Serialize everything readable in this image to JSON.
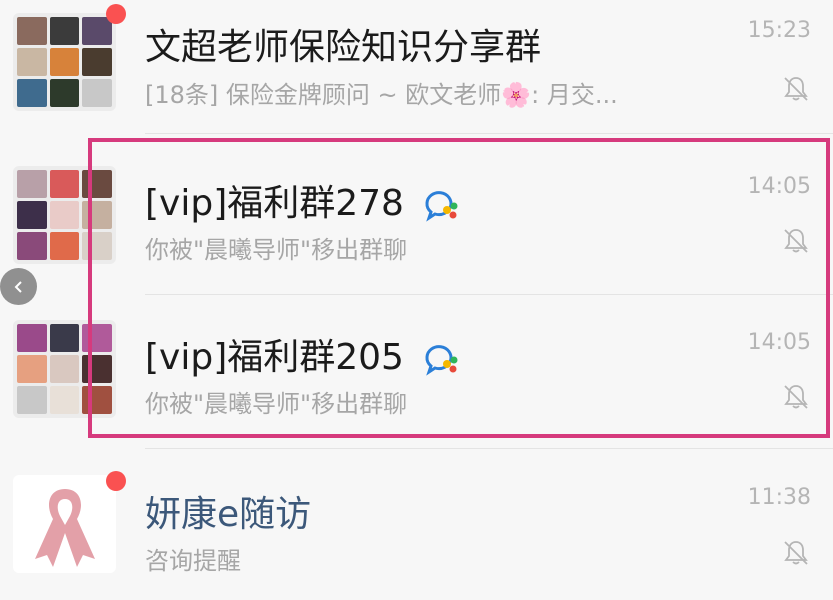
{
  "chats": [
    {
      "title": "文超老师保险知识分享群",
      "preview": "[18条] 保险金牌顾问 ~ 欧文老师🌸: 月交...",
      "time": "15:23",
      "unread": true,
      "muted": true,
      "avatar_type": "group-grid"
    },
    {
      "title": "[vip]福利群278",
      "preview": "你被\"晨曦导师\"移出群聊",
      "time": "14:05",
      "muted": true,
      "has_chat_badge": true,
      "avatar_type": "group-grid"
    },
    {
      "title": "[vip]福利群205",
      "preview": "你被\"晨曦导师\"移出群聊",
      "time": "14:05",
      "muted": true,
      "has_chat_badge": true,
      "avatar_type": "group-grid"
    },
    {
      "title": "妍康e随访",
      "preview": "咨询提醒",
      "time": "11:38",
      "unread": true,
      "muted": true,
      "avatar_type": "pink-ribbon"
    }
  ],
  "colors": {
    "highlight_border": "#d63a7d",
    "unread_dot": "#fa5151",
    "official_title": "#3c587a"
  }
}
